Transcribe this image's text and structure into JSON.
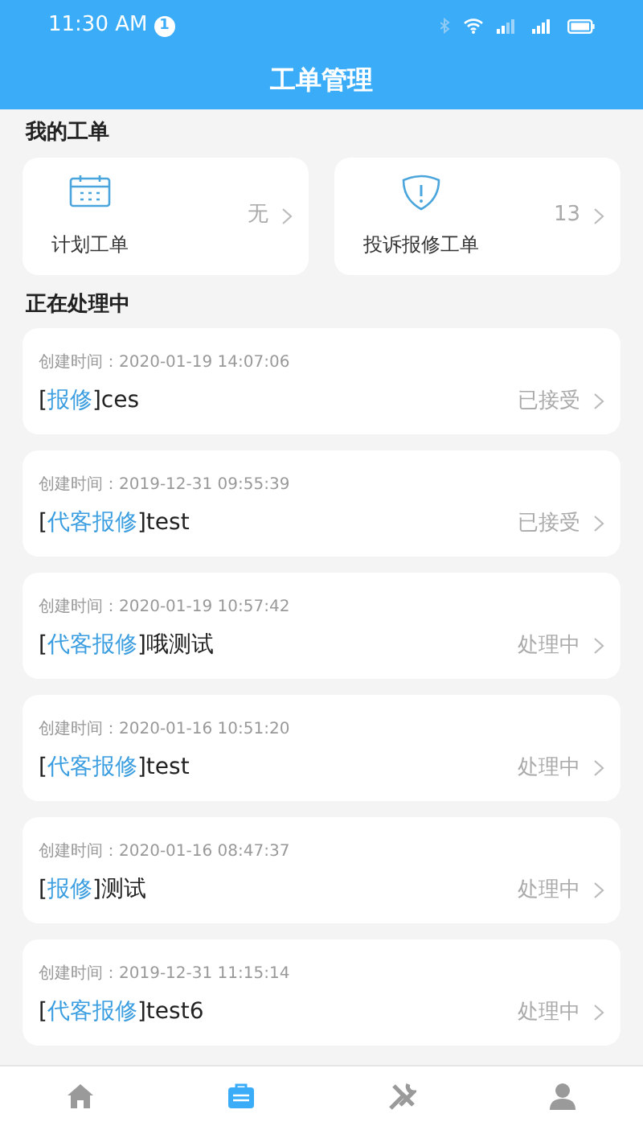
{
  "status_bar": {
    "time": "11:30 AM",
    "notification_count": "1"
  },
  "header": {
    "title": "工单管理"
  },
  "my_orders": {
    "title": "我的工单",
    "tiles": [
      {
        "kind": "calendar",
        "label": "计划工单",
        "count": "无"
      },
      {
        "kind": "shield",
        "label": "投诉报修工单",
        "count": "13"
      }
    ]
  },
  "in_progress": {
    "title": "正在处理中",
    "orders": [
      {
        "created": "创建时间：2020-01-19 14:07:06",
        "title_parts": [
          {
            "text": "["
          },
          {
            "text": "报修",
            "kind": "tag"
          },
          {
            "text": "]ces"
          }
        ],
        "status": "已接受"
      },
      {
        "created": "创建时间：2019-12-31 09:55:39",
        "title_parts": [
          {
            "text": "["
          },
          {
            "text": "代客报修",
            "kind": "tag"
          },
          {
            "text": "]test"
          }
        ],
        "status": "已接受"
      },
      {
        "created": "创建时间：2020-01-19 10:57:42",
        "title_parts": [
          {
            "text": "["
          },
          {
            "text": "代客报修",
            "kind": "tag"
          },
          {
            "text": "]哦测试"
          }
        ],
        "status": "处理中"
      },
      {
        "created": "创建时间：2020-01-16 10:51:20",
        "title_parts": [
          {
            "text": "["
          },
          {
            "text": "代客报修",
            "kind": "tag"
          },
          {
            "text": "]test"
          }
        ],
        "status": "处理中"
      },
      {
        "created": "创建时间：2020-01-16 08:47:37",
        "title_parts": [
          {
            "text": "["
          },
          {
            "text": "报修",
            "kind": "tag"
          },
          {
            "text": "]测试"
          }
        ],
        "status": "处理中"
      },
      {
        "created": "创建时间：2019-12-31 11:15:14",
        "title_parts": [
          {
            "text": "["
          },
          {
            "text": "代客报修",
            "kind": "tag"
          },
          {
            "text": "]test6"
          }
        ],
        "status": "处理中"
      }
    ]
  },
  "bottom_nav": [
    {
      "kind": "home",
      "selected": false
    },
    {
      "kind": "orders",
      "selected": true
    },
    {
      "kind": "tools",
      "selected": false
    },
    {
      "kind": "profile",
      "selected": false
    }
  ]
}
